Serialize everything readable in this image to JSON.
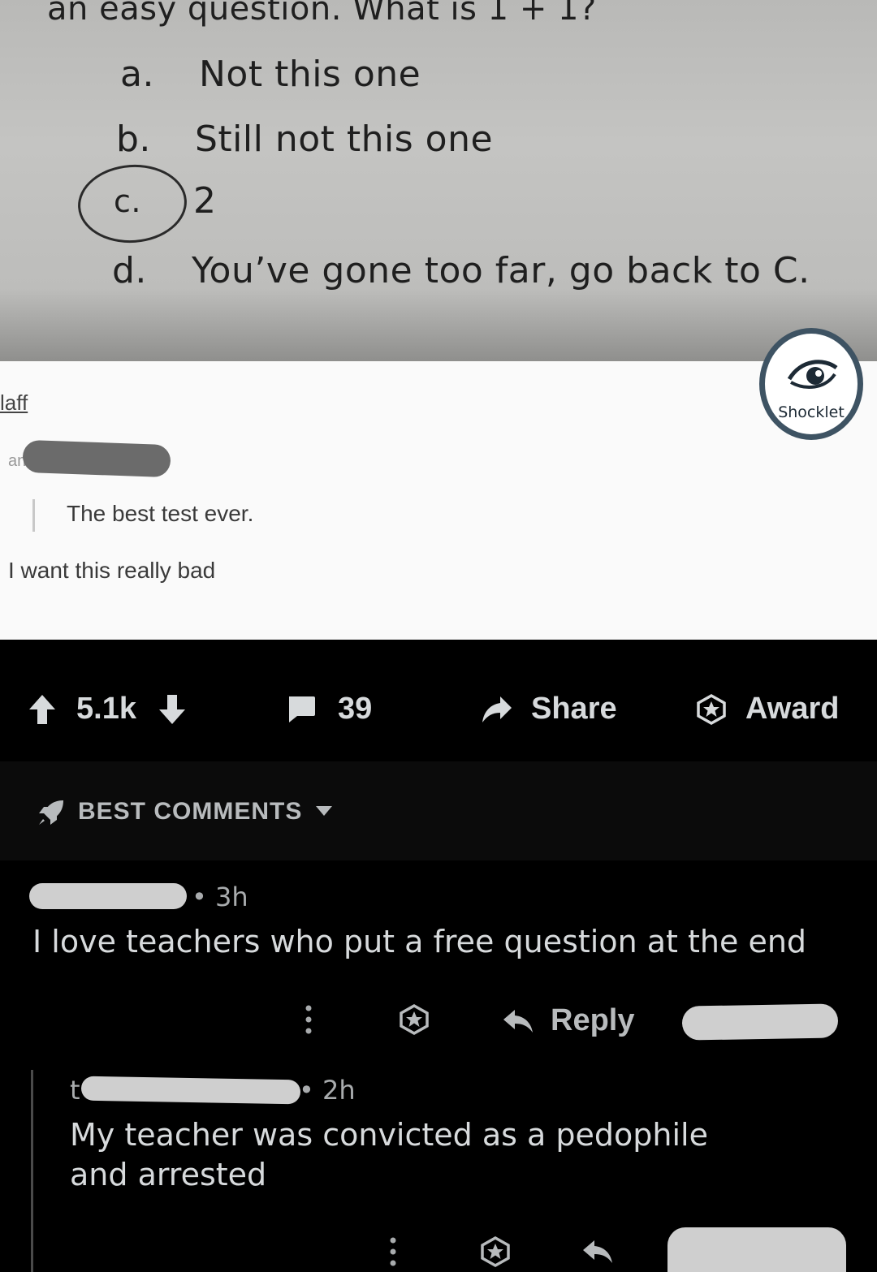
{
  "post_image": {
    "question": "an easy question. What is 1 + 1?",
    "options": [
      {
        "letter": "a.",
        "text": "Not this one"
      },
      {
        "letter": "b.",
        "text": "Still not this one"
      },
      {
        "letter": "c.",
        "text": "2"
      },
      {
        "letter": "d.",
        "text": "You’ve gone too far, go back to C."
      }
    ],
    "social": {
      "poster_fragment": "laff",
      "commenter_fragment": "an",
      "comment_1": "The best test ever.",
      "comment_2": "I want this really bad"
    },
    "watermark": "Shocklet"
  },
  "actions": {
    "score": "5.1k",
    "comments_count": "39",
    "share_label": "Share",
    "award_label": "Award"
  },
  "comments_header": {
    "sort_label": "BEST COMMENTS"
  },
  "comments": [
    {
      "time": "• 3h",
      "body": "I love teachers who put a free question at the end",
      "reply_label": "Reply"
    },
    {
      "username_start": "t",
      "time": "• 2h",
      "body_line1": "My teacher was convicted as a pedophile",
      "body_line2": "and arrested"
    }
  ],
  "colors": {
    "background": "#000000",
    "text": "#d7dadc",
    "muted": "#a8abad",
    "watermark_ring": "#3e5363"
  }
}
